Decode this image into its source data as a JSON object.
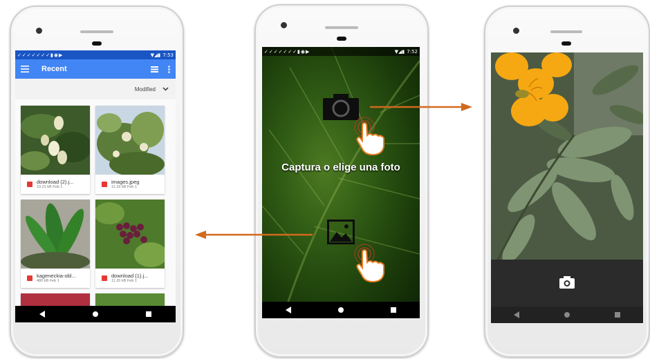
{
  "phone_left": {
    "status_time": "7:53",
    "appbar_title": "Recent",
    "sort_label": "Modified",
    "files": [
      {
        "name": "download (2).j...",
        "meta": "10.21 kB Feb 1"
      },
      {
        "name": "images.jpeg",
        "meta": "11.16 kB Feb 1"
      },
      {
        "name": "kageneckia-obl...",
        "meta": "480 kB Feb 1"
      },
      {
        "name": "download (1).j...",
        "meta": "11.20 kB Feb 1"
      }
    ]
  },
  "phone_center": {
    "status_time": "7:52",
    "prompt": "Captura o elige una foto"
  },
  "phone_right": {},
  "icons": {
    "menu": "hamburger-menu-icon",
    "view": "list-view-icon",
    "overflow": "more-vert-icon",
    "chevron": "chevron-down-icon",
    "camera": "camera-icon",
    "gallery": "image-gallery-icon",
    "hand": "pointing-hand-icon"
  },
  "colors": {
    "appbar": "#4285f4",
    "arrow": "#d2691e",
    "file_icon": "#e53935"
  }
}
